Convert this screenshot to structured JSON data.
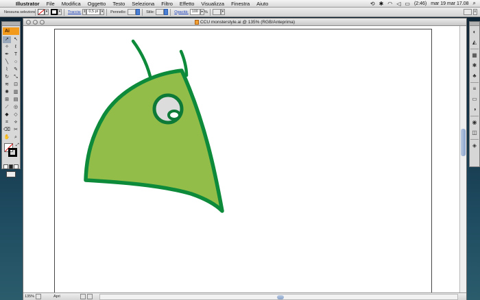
{
  "menubar": {
    "app_name": "Illustrator",
    "menus": [
      "File",
      "Modifica",
      "Oggetto",
      "Testo",
      "Seleziona",
      "Filtro",
      "Effetto",
      "Visualizza",
      "Finestra",
      "Aiuto"
    ],
    "battery": "(2:46)",
    "clock": "mar 19 mar  17.08"
  },
  "controlbar": {
    "selection": "Nessuna selezione",
    "stroke_link": "Traccia:",
    "stroke_weight": "0,5 pt",
    "brush_label": "Pennello:",
    "style_label": "Stile:",
    "opacity_link": "Opacità:",
    "opacity_value": "100",
    "percent": "%"
  },
  "document": {
    "title": "CCU monsterstyle.ai @ 135% (RGB/Anteprima)"
  },
  "statusbar": {
    "zoom": "135%",
    "status": "Apri"
  },
  "toolbox": {
    "logo": "Ai",
    "tools": [
      "selection-tool",
      "direct-selection-tool",
      "magic-wand-tool",
      "lasso-tool",
      "pen-tool",
      "type-tool",
      "line-tool",
      "ellipse-tool",
      "paintbrush-tool",
      "pencil-tool",
      "rotate-tool",
      "scale-tool",
      "warp-tool",
      "free-transform-tool",
      "symbol-sprayer-tool",
      "graph-tool",
      "mesh-tool",
      "gradient-tool",
      "eyedropper-tool",
      "blend-tool",
      "live-paint-tool",
      "live-paint-selection-tool",
      "crop-tool",
      "slice-tool",
      "eraser-tool",
      "scissors-tool",
      "hand-tool",
      "zoom-tool"
    ]
  },
  "artwork": {
    "body_fill": "#93bd49",
    "outline": "#0d8a3a",
    "eye_white": "#dcdcdc"
  }
}
